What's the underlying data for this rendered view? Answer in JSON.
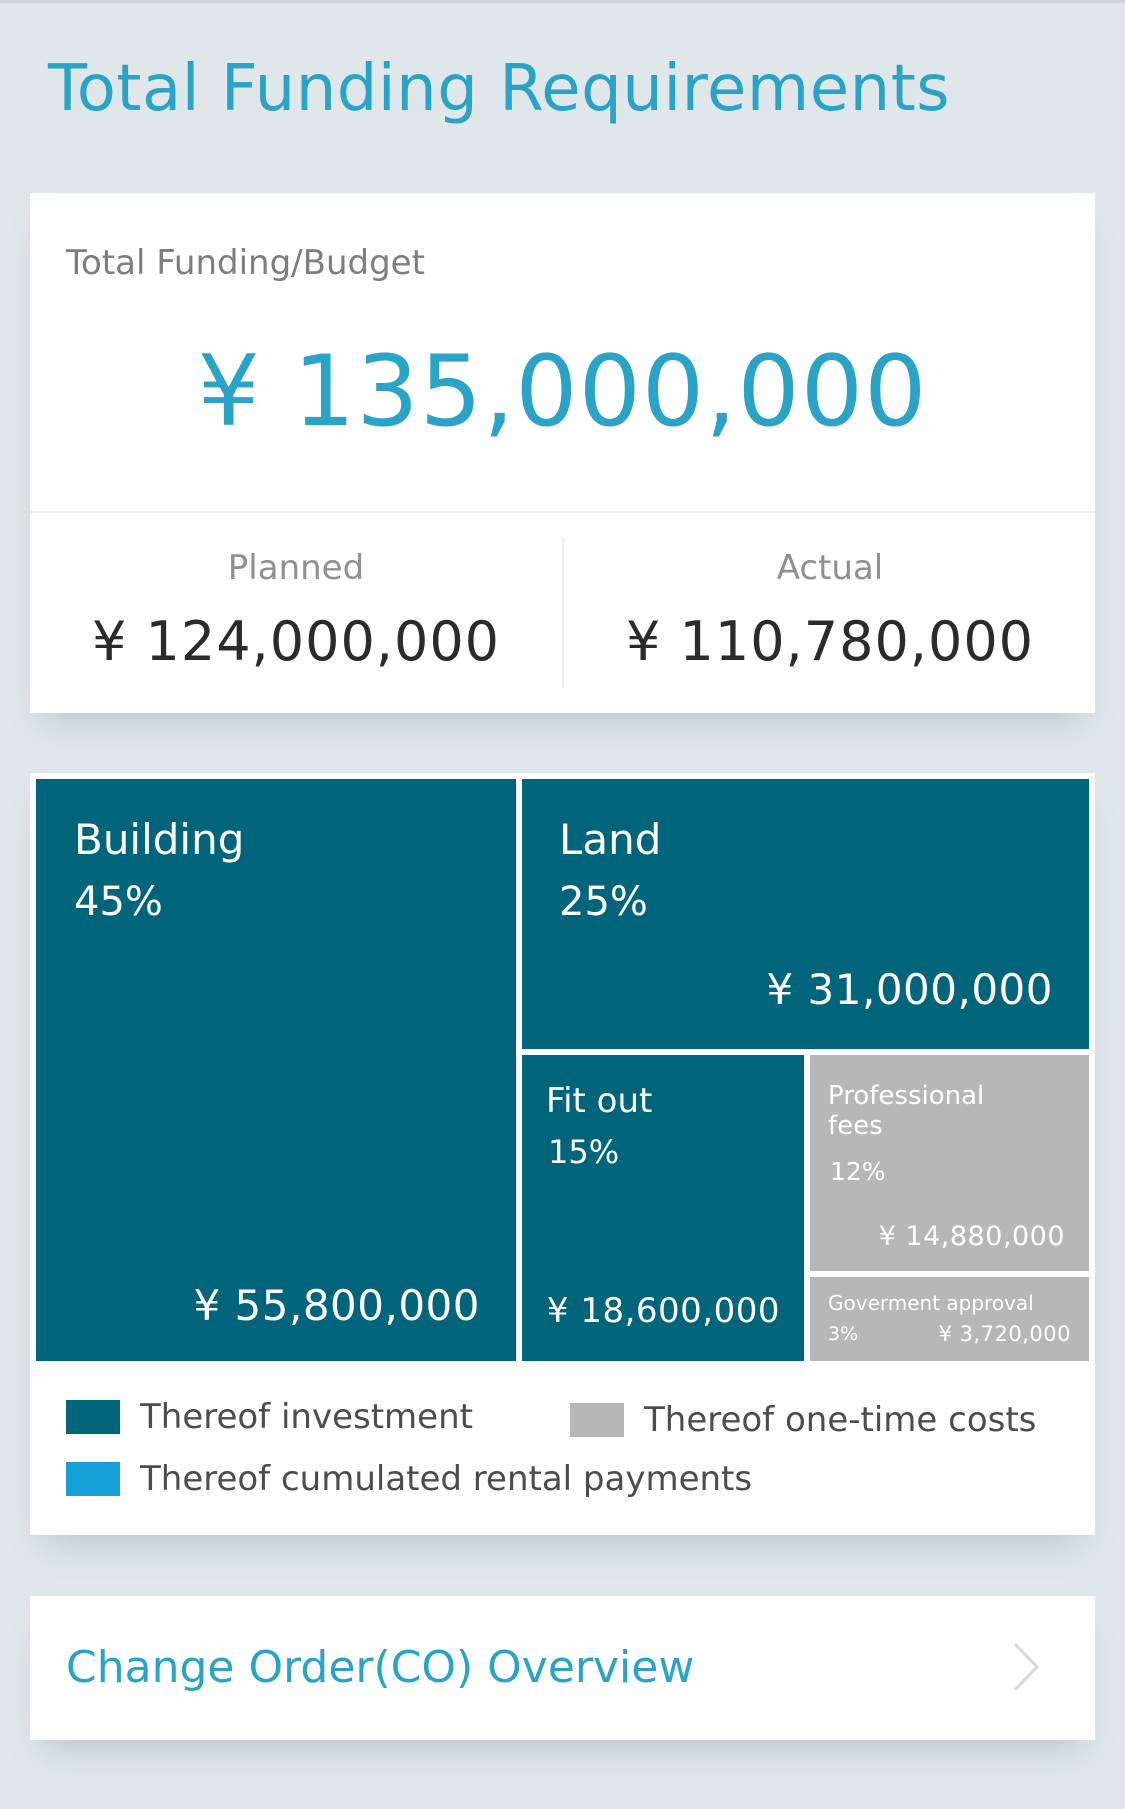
{
  "header": {
    "title": "Total Funding Requirements"
  },
  "budget": {
    "label": "Total Funding/Budget",
    "total": "¥ 135,000,000",
    "planned": {
      "label": "Planned",
      "value": "¥ 124,000,000"
    },
    "actual": {
      "label": "Actual",
      "value": "¥ 110,780,000"
    }
  },
  "colors": {
    "accent": "#2aa3c7",
    "investment": "#00657b",
    "one_time": "#b7b7b7",
    "rental": "#14a0d6"
  },
  "treemap": {
    "tiles": [
      {
        "name": "Building",
        "percent": "45%",
        "amount": "¥ 55,800,000",
        "category": "Thereof investment"
      },
      {
        "name": "Land",
        "percent": "25%",
        "amount": "¥ 31,000,000",
        "category": "Thereof investment"
      },
      {
        "name": "Fit out",
        "percent": "15%",
        "amount": "¥ 18,600,000",
        "category": "Thereof investment"
      },
      {
        "name": "Professional\nfees",
        "percent": "12%",
        "amount": "¥ 14,880,000",
        "category": "Thereof one-time costs"
      },
      {
        "name": "Goverment approval",
        "percent": "3%",
        "amount": "¥ 3,720,000",
        "category": "Thereof one-time costs"
      }
    ]
  },
  "legend": {
    "investment": "Thereof investment",
    "one_time": "Thereof one-time costs",
    "rental": "Thereof cumulated rental payments"
  },
  "change_order": {
    "label": "Change Order(CO) Overview",
    "icon": "chevron-right-icon"
  }
}
